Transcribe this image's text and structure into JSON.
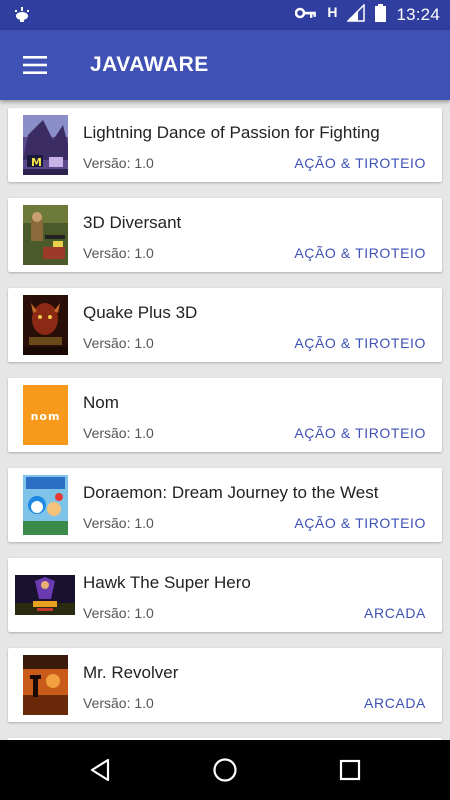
{
  "status_bar": {
    "time": "13:24",
    "network_letter": "H",
    "icons": [
      "android-debug-icon",
      "vpn-key-icon",
      "signal-icon",
      "battery-icon"
    ]
  },
  "app_bar": {
    "title": "JAVAWARE",
    "menu_icon": "hamburger-menu-icon"
  },
  "colors": {
    "status_bar": "#303f9f",
    "app_bar": "#3f51b5",
    "accent": "#3f51b5",
    "background": "#e6e6e6"
  },
  "games": [
    {
      "name": "Lightning Dance of Passion for Fighting",
      "version": "Versão: 1.0",
      "category": "AÇÃO & TIROTEIO"
    },
    {
      "name": "3D Diversant",
      "version": "Versão: 1.0",
      "category": "AÇÃO & TIROTEIO"
    },
    {
      "name": "Quake Plus 3D",
      "version": "Versão: 1.0",
      "category": "AÇÃO & TIROTEIO"
    },
    {
      "name": "Nom",
      "version": "Versão: 1.0",
      "category": "AÇÃO & TIROTEIO",
      "logo_text": "nom"
    },
    {
      "name": "Doraemon: Dream Journey to the West",
      "version": "Versão: 1.0",
      "category": "AÇÃO & TIROTEIO"
    },
    {
      "name": "Hawk The Super Hero",
      "version": "Versão: 1.0",
      "category": "ARCADA"
    },
    {
      "name": "Mr. Revolver",
      "version": "Versão: 1.0",
      "category": "ARCADA"
    }
  ],
  "nav_bar": {
    "icons": [
      "back-icon",
      "home-icon",
      "recents-icon"
    ]
  }
}
